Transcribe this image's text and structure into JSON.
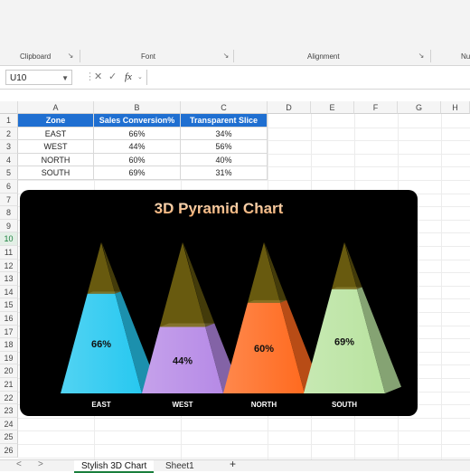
{
  "ribbon": {
    "groups": [
      {
        "label": "Clipboard"
      },
      {
        "label": "Font"
      },
      {
        "label": "Alignment"
      },
      {
        "label": "Nu"
      }
    ]
  },
  "formula_bar": {
    "name_box": "U10",
    "cancel_icon": "✕",
    "enter_icon": "✓",
    "fx_label": "fx",
    "value": ""
  },
  "columns": [
    "A",
    "B",
    "C",
    "D",
    "E",
    "F",
    "G",
    "H"
  ],
  "rows": [
    "1",
    "2",
    "3",
    "4",
    "5",
    "6",
    "7",
    "8",
    "9",
    "10",
    "11",
    "12",
    "13",
    "14",
    "15",
    "16",
    "17",
    "18",
    "19",
    "20",
    "21",
    "22",
    "23",
    "24",
    "25",
    "26"
  ],
  "selected_row": "10",
  "table": {
    "headers": [
      "Zone",
      "Sales Conversion%",
      "Transparent Slice"
    ],
    "rows": [
      [
        "EAST",
        "66%",
        "34%"
      ],
      [
        "WEST",
        "44%",
        "56%"
      ],
      [
        "NORTH",
        "60%",
        "40%"
      ],
      [
        "SOUTH",
        "69%",
        "31%"
      ]
    ]
  },
  "chart_data": {
    "type": "bar",
    "subtype": "3d-pyramid-stacked-percent",
    "title": "3D Pyramid Chart",
    "categories": [
      "EAST",
      "WEST",
      "NORTH",
      "SOUTH"
    ],
    "series": [
      {
        "name": "Sales Conversion%",
        "values": [
          66,
          44,
          60,
          69
        ],
        "data_labels": [
          "66%",
          "44%",
          "60%",
          "69%"
        ]
      },
      {
        "name": "Transparent Slice",
        "values": [
          34,
          56,
          40,
          31
        ]
      }
    ],
    "ylim": [
      0,
      100
    ],
    "legend": "none",
    "grid": false,
    "background": "#000000",
    "colors": {
      "EAST": "#27c8f0",
      "WEST": "#b68ae6",
      "NORTH": "#ff6a1f",
      "SOUTH": "#b9e3a0",
      "transparent_slice": "#7a6a12",
      "title_color": "#f6c99a"
    }
  },
  "sheet_tabs": {
    "tabs": [
      {
        "label": "Stylish 3D Chart",
        "active": true
      },
      {
        "label": "Sheet1",
        "active": false
      }
    ],
    "add_label": "+",
    "prev_label": "<",
    "next_label": ">"
  }
}
